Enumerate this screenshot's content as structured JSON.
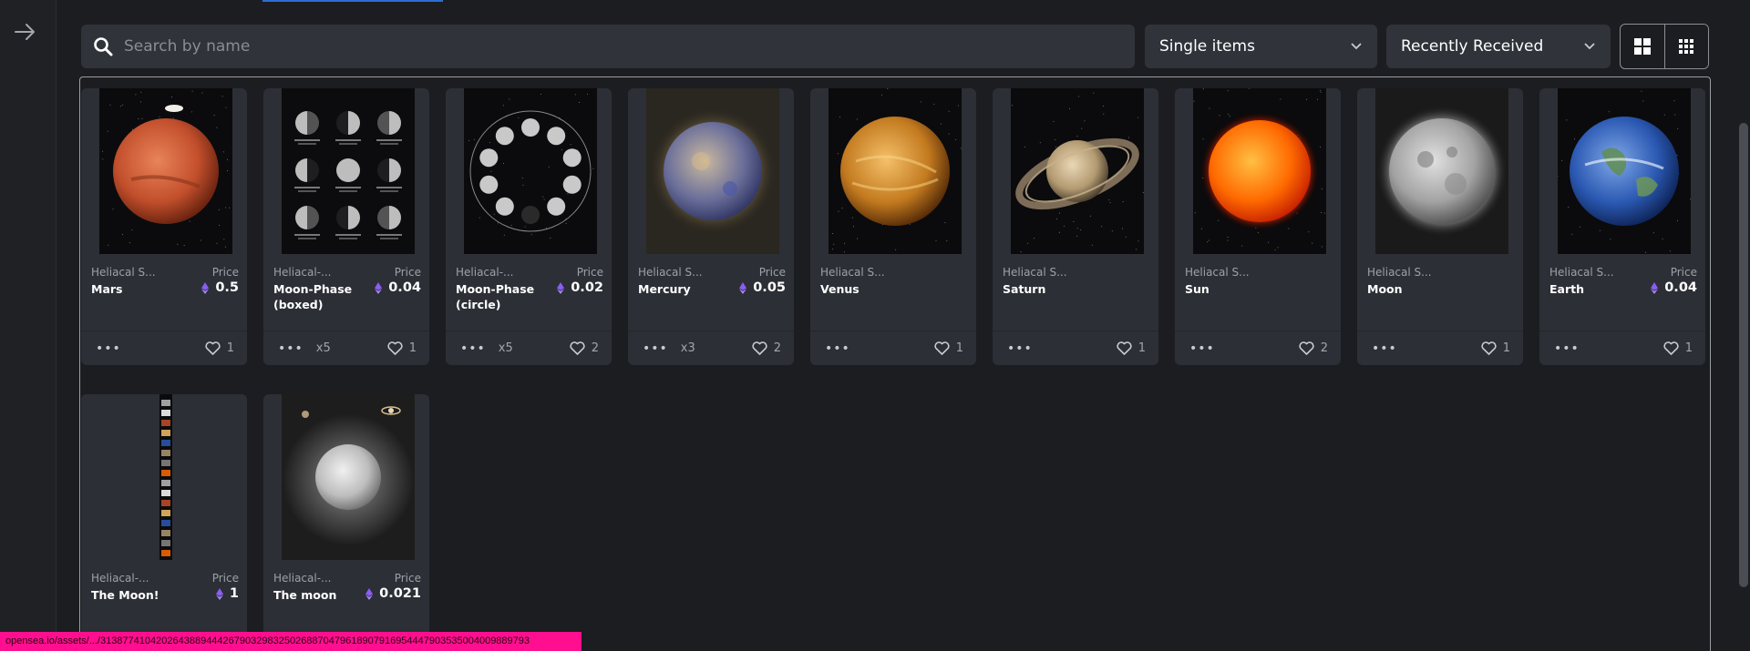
{
  "search": {
    "placeholder": "Search by name"
  },
  "filters": {
    "type_selected": "Single items",
    "sort_selected": "Recently Received"
  },
  "labels": {
    "price": "Price"
  },
  "status_url": "opensea.io/assets/.../31387741042026438894442679032983250268870479618907916954447903535004009889793",
  "colors": {
    "accent_blue": "#2d6ed1",
    "eth_purple": "#8b5cf6",
    "status_bar": "#ff0f8f"
  },
  "cards": [
    {
      "collection": "Heliacal S...",
      "name": "Mars",
      "price": "0.5",
      "quantity": "",
      "likes": "1",
      "image": "mars"
    },
    {
      "collection": "Heliacal-...",
      "name": "Moon-Phase (boxed)",
      "price": "0.04",
      "quantity": "x5",
      "likes": "1",
      "image": "moon-phase-boxed"
    },
    {
      "collection": "Heliacal-...",
      "name": "Moon-Phase (circle)",
      "price": "0.02",
      "quantity": "x5",
      "likes": "2",
      "image": "moon-phase-circle"
    },
    {
      "collection": "Heliacal S...",
      "name": "Mercury",
      "price": "0.05",
      "quantity": "x3",
      "likes": "2",
      "image": "mercury"
    },
    {
      "collection": "Heliacal S...",
      "name": "Venus",
      "price": "",
      "quantity": "",
      "likes": "1",
      "image": "venus"
    },
    {
      "collection": "Heliacal S...",
      "name": "Saturn",
      "price": "",
      "quantity": "",
      "likes": "1",
      "image": "saturn"
    },
    {
      "collection": "Heliacal S...",
      "name": "Sun",
      "price": "",
      "quantity": "",
      "likes": "2",
      "image": "sun"
    },
    {
      "collection": "Heliacal S...",
      "name": "Moon",
      "price": "",
      "quantity": "",
      "likes": "1",
      "image": "moon"
    },
    {
      "collection": "Heliacal S...",
      "name": "Earth",
      "price": "0.04",
      "quantity": "",
      "likes": "1",
      "image": "earth"
    },
    {
      "collection": "Heliacal-...",
      "name": "The Moon!",
      "price": "1",
      "quantity": "",
      "likes": "",
      "image": "the-moon-strip"
    },
    {
      "collection": "Heliacal-...",
      "name": "The moon",
      "price": "0.021",
      "quantity": "",
      "likes": "",
      "image": "the-moon-poster"
    }
  ]
}
